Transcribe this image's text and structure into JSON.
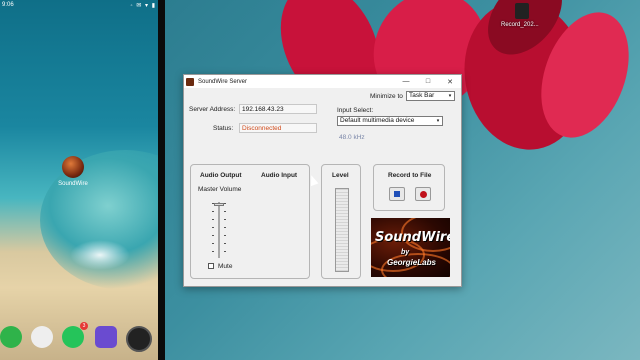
{
  "phone": {
    "status_time": "9:06",
    "status_icons": "◦ ✉ ▾ ▮",
    "app_label": "SoundWire",
    "whatsapp_badge": "3"
  },
  "desktop": {
    "icon_label": "Record_202..."
  },
  "window": {
    "title": "SoundWire Server",
    "minimize_to_label": "Minimize to",
    "minimize_to_value": "Task Bar",
    "server_address_label": "Server Address:",
    "server_address_value": "192.168.43.23",
    "status_label": "Status:",
    "status_value": "Disconnected",
    "status_color": "#d04a1a",
    "input_select_label": "Input Select:",
    "input_select_value": "Default multimedia device",
    "sample_rate": "48.0 kHz",
    "audio_output_label": "Audio Output",
    "audio_input_label": "Audio Input",
    "master_volume_label": "Master Volume",
    "mute_label": "Mute",
    "level_label": "Level",
    "record_label": "Record to File",
    "logo_line1": "SoundWire",
    "logo_line2": "by",
    "logo_line3": "GeorgieLabs",
    "minimize_glyph": "—",
    "maximize_glyph": "□",
    "close_glyph": "✕",
    "dropdown_glyph": "▾"
  }
}
